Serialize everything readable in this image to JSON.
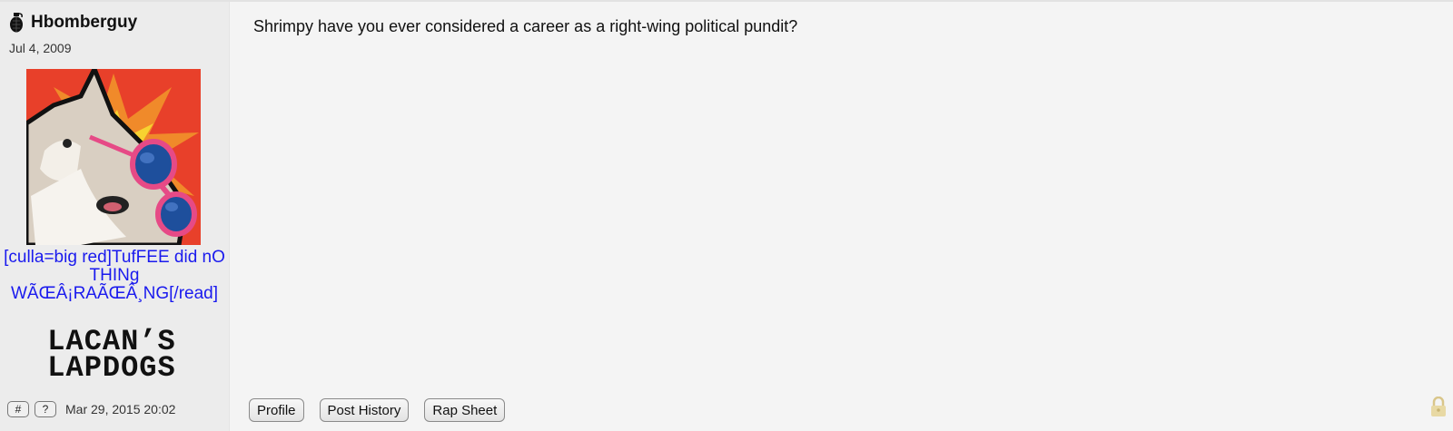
{
  "post": {
    "author": {
      "username": "Hbomberguy",
      "reg_date": "Jul 4, 2009",
      "custom_title": "[culla=big red]TufFEE did nO THINg WÃŒÂ¡RAÃŒÂ¸NG[/read]",
      "group_badge_text": "LACAN'S LAPDOGS",
      "username_icon": "grenade-icon",
      "avatar_description": "husky-with-pink-sunglasses"
    },
    "body": "Shrimpy have you ever considered a career as a right-wing political pundit?",
    "meta": {
      "hash_label": "#",
      "help_label": "?",
      "timestamp": "Mar 29, 2015 20:02"
    },
    "actions": {
      "profile": "Profile",
      "post_history": "Post History",
      "rap_sheet": "Rap Sheet"
    },
    "lock_icon": "lock-icon"
  }
}
